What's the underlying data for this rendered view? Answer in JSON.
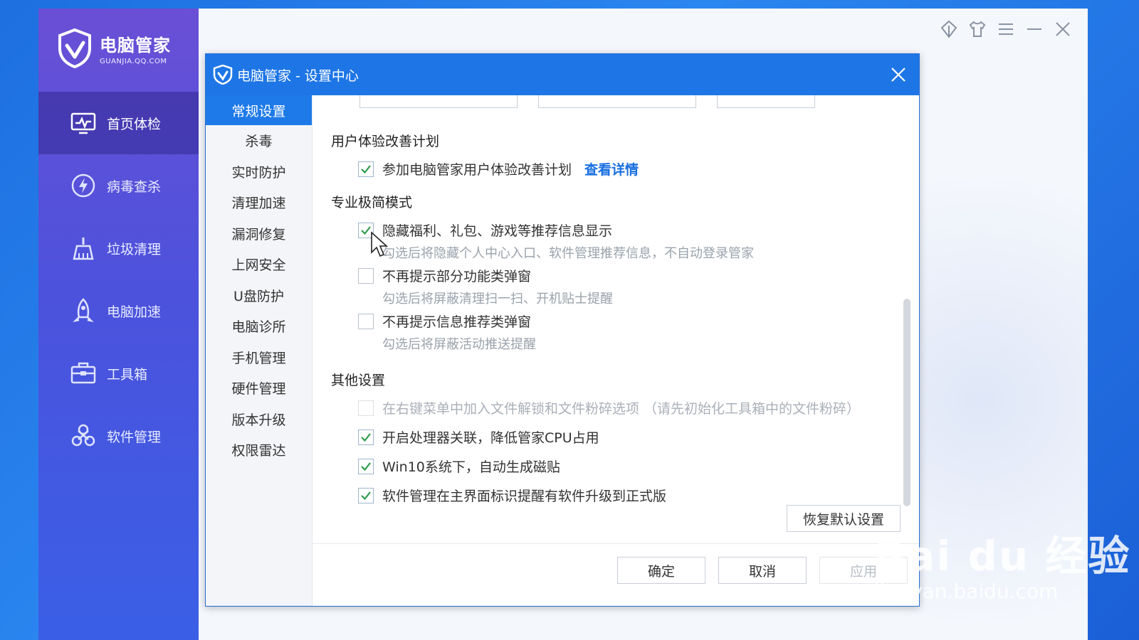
{
  "app": {
    "logo_title": "电脑管家",
    "logo_subtitle": "GUANJIA.QQ.COM",
    "nav": [
      {
        "label": "首页体检",
        "icon": "monitor-icon",
        "active": true
      },
      {
        "label": "病毒查杀",
        "icon": "lightning-shield-icon",
        "active": false
      },
      {
        "label": "垃圾清理",
        "icon": "broom-icon",
        "active": false
      },
      {
        "label": "电脑加速",
        "icon": "rocket-icon",
        "active": false
      },
      {
        "label": "工具箱",
        "icon": "toolbox-icon",
        "active": false
      },
      {
        "label": "软件管理",
        "icon": "apps-icon",
        "active": false
      }
    ],
    "top_icons": [
      "skin-diamond-icon",
      "shirt-icon",
      "menu-icon",
      "minimize-icon",
      "close-icon"
    ]
  },
  "dialog": {
    "title": "电脑管家 - 设置中心",
    "menu": [
      "常规设置",
      "杀毒",
      "实时防护",
      "清理加速",
      "漏洞修复",
      "上网安全",
      "U盘防护",
      "电脑诊所",
      "手机管理",
      "硬件管理",
      "版本升级",
      "权限雷达"
    ],
    "active_menu": "常规设置",
    "sections": {
      "ux": {
        "title": "用户体验改善计划",
        "option": "参加电脑管家用户体验改善计划",
        "link": "查看详情",
        "checked": true
      },
      "pro": {
        "title": "专业极简模式",
        "options": [
          {
            "label": "隐藏福利、礼包、游戏等推荐信息显示",
            "hint": "勾选后将隐藏个人中心入口、软件管理推荐信息，不自动登录管家",
            "checked": true
          },
          {
            "label": "不再提示部分功能类弹窗",
            "hint": "勾选后将屏蔽清理扫一扫、开机贴士提醒",
            "checked": false
          },
          {
            "label": "不再提示信息推荐类弹窗",
            "hint": "勾选后将屏蔽活动推送提醒",
            "checked": false
          }
        ]
      },
      "other": {
        "title": "其他设置",
        "options": [
          {
            "label": "在右键菜单中加入文件解锁和文件粉碎选项 （请先初始化工具箱中的文件粉碎）",
            "checked": false,
            "disabled": true
          },
          {
            "label": "开启处理器关联，降低管家CPU占用",
            "checked": true,
            "disabled": false
          },
          {
            "label": "Win10系统下，自动生成磁贴",
            "checked": true,
            "disabled": false
          },
          {
            "label": "软件管理在主界面标识提醒有软件升级到正式版",
            "checked": true,
            "disabled": false
          }
        ]
      }
    },
    "restore_button": "恢复默认设置",
    "buttons": {
      "ok": "确定",
      "cancel": "取消",
      "apply": "应用"
    }
  },
  "watermark": {
    "big": "Bai du 经验",
    "small": "jingyan.baidu.com"
  },
  "colors": {
    "title_bar": "#1e76e6",
    "active_menu": "#1e7ae8",
    "link": "#1a6fe0",
    "sidebar_top": "#6a4fd6",
    "sidebar_bottom": "#3a5fe6"
  }
}
